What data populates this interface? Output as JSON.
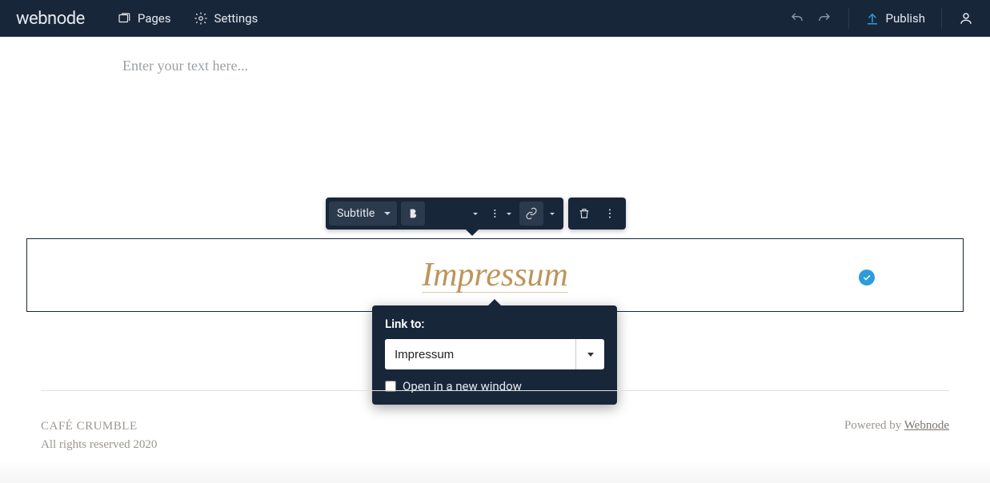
{
  "topbar": {
    "logo": "webnode",
    "pages_label": "Pages",
    "settings_label": "Settings",
    "publish_label": "Publish"
  },
  "editor": {
    "placeholder": "Enter your text here...",
    "style_select": "Subtitle"
  },
  "title": {
    "text": "Impressum"
  },
  "link_popup": {
    "label": "Link to:",
    "value": "Impressum",
    "new_window_label": "Open in a new window"
  },
  "footer": {
    "brand": "CAFÉ CRUMBLE",
    "rights": "All rights reserved 2020",
    "powered_prefix": "Powered by ",
    "powered_link": "Webnode"
  }
}
